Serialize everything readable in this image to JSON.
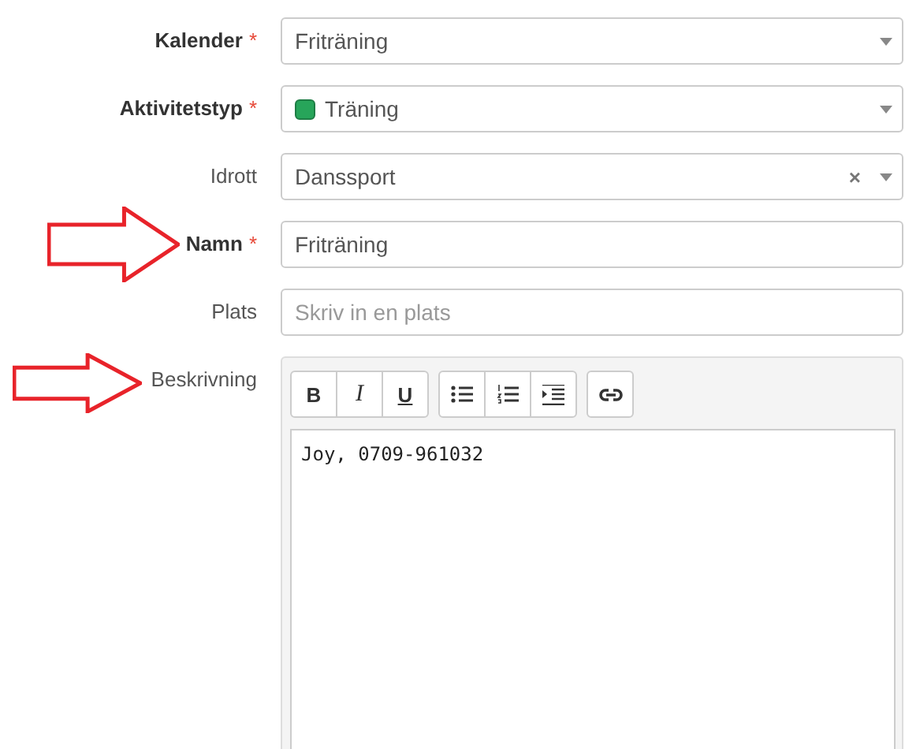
{
  "fields": [
    {
      "kind": "select",
      "label": "Kalender",
      "required": true,
      "required_mark": "*",
      "value": "Friträning"
    },
    {
      "kind": "select",
      "label": "Aktivitetstyp",
      "required": true,
      "required_mark": "*",
      "value": "Träning",
      "color": "#27a55a"
    },
    {
      "kind": "select",
      "label": "Idrott",
      "required": false,
      "value": "Danssport",
      "clear": "×"
    },
    {
      "kind": "input",
      "label": "Namn",
      "required": true,
      "required_mark": "*",
      "value": "Friträning",
      "annotated": true
    },
    {
      "kind": "input",
      "label": "Plats",
      "required": false,
      "placeholder": "Skriv in en plats"
    },
    {
      "kind": "editor",
      "label": "Beskrivning",
      "required": false,
      "annotated": true,
      "value": "Joy, 0709-961032",
      "toolbar": [
        [
          {
            "kind": "bold",
            "label": "B"
          },
          {
            "kind": "italic",
            "label": "I"
          },
          {
            "kind": "underline",
            "label": "U"
          }
        ],
        [
          {
            "kind": "bullets"
          },
          {
            "kind": "numbers"
          },
          {
            "kind": "indent"
          }
        ],
        [
          {
            "kind": "link"
          }
        ]
      ]
    }
  ]
}
